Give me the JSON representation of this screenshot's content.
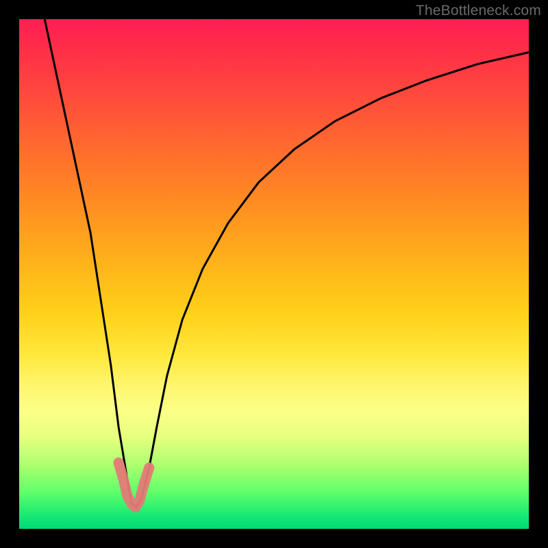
{
  "watermark": "TheBottleneck.com",
  "colors": {
    "frame": "#000000",
    "gradient_top": "#FF1E52",
    "gradient_mid_upper": "#FF8C22",
    "gradient_mid": "#FFE83E",
    "gradient_lower": "#A6FF6E",
    "gradient_bottom": "#00D977",
    "curve": "#000000",
    "highlight_stroke": "#E47A77"
  },
  "chart_data": {
    "type": "line",
    "title": "",
    "xlabel": "",
    "ylabel": "",
    "xlim": [
      0,
      100
    ],
    "ylim": [
      0,
      100
    ],
    "note": "X is horizontal position (0=left,100=right); Y is vertical position (0=bottom,100=top). Curve is a V-shaped bottleneck profile with minimum near x≈22.",
    "series": [
      {
        "name": "bottleneck-curve",
        "x": [
          5,
          8,
          11,
          14,
          16,
          18,
          19.5,
          21,
          22,
          23,
          24,
          25.5,
          27,
          29,
          32,
          36,
          41,
          47,
          54,
          62,
          71,
          80,
          90,
          100
        ],
        "y": [
          100,
          86,
          72,
          58,
          45,
          32,
          20,
          11,
          5,
          4.2,
          6,
          12,
          20,
          30,
          41,
          51,
          60,
          68,
          74.5,
          80,
          84.5,
          88,
          91.2,
          93.5
        ]
      }
    ],
    "highlight_segment": {
      "name": "bottom-highlight",
      "x": [
        19.5,
        20.5,
        21.2,
        22,
        22.8,
        23.6,
        24.4,
        25.5
      ],
      "y": [
        13,
        9.5,
        6.5,
        5,
        4.2,
        5.5,
        8.5,
        12
      ]
    }
  }
}
